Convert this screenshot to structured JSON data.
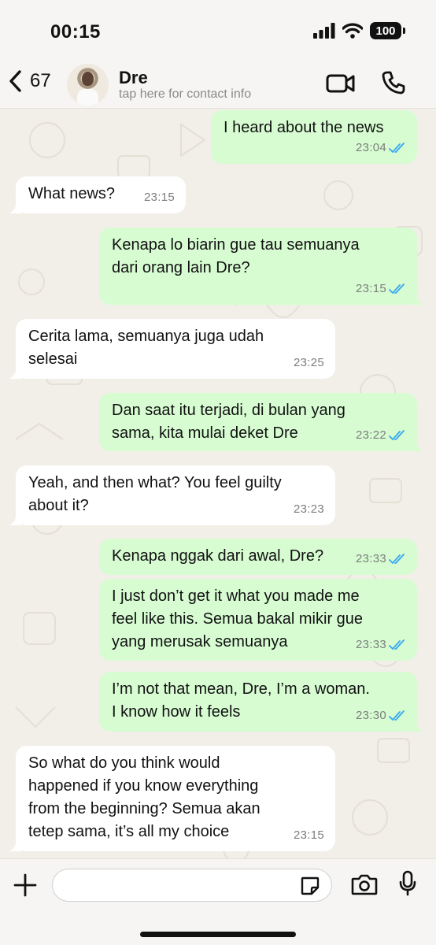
{
  "status": {
    "time": "00:15",
    "battery": "100"
  },
  "header": {
    "back_count": "67",
    "name": "Dre",
    "subtitle": "tap here for contact info"
  },
  "messages": [
    {
      "dir": "out",
      "text": "I heard about the news",
      "time": "23:04",
      "read": true
    },
    {
      "dir": "in",
      "text": "What news?",
      "time": "23:15"
    },
    {
      "dir": "out",
      "text": "Kenapa lo biarin gue tau semuanya\ndari orang lain Dre?",
      "time": "23:15",
      "read": true
    },
    {
      "dir": "in",
      "text": "Cerita lama, semuanya juga udah\nselesai",
      "time": "23:25"
    },
    {
      "dir": "out",
      "text": "Dan saat itu terjadi, di bulan yang\nsama, kita mulai deket Dre",
      "time": "23:22",
      "read": true
    },
    {
      "dir": "in",
      "text": "Yeah, and then what? You feel guilty\nabout it?",
      "time": "23:23"
    },
    {
      "dir": "out",
      "text": "Kenapa nggak dari awal, Dre?",
      "time": "23:33",
      "read": true
    },
    {
      "dir": "out",
      "text": "I just don’t get it what you made me\nfeel like this. Semua bakal mikir gue\nyang merusak semuanya",
      "time": "23:33",
      "read": true
    },
    {
      "dir": "out",
      "text": "I’m not that mean, Dre, I’m a woman.\nI know how it feels",
      "time": "23:30",
      "read": true
    },
    {
      "dir": "in",
      "text": "So what do you think would\nhappened if you know everything\nfrom the beginning? Semua akan\ntetep sama, it’s all my choice",
      "time": "23:15"
    }
  ],
  "colors": {
    "accent": "#007aff",
    "out_bubble": "#d7fcd2",
    "in_bubble": "#ffffff",
    "read_check": "#34a8f0"
  },
  "icons": [
    "back-chevron-icon",
    "video-call-icon",
    "phone-icon",
    "plus-icon",
    "sticker-icon",
    "camera-icon",
    "microphone-icon"
  ]
}
